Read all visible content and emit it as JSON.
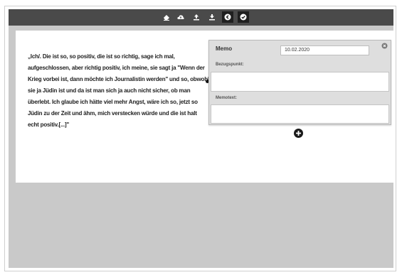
{
  "toolbar": {
    "buttons": [
      {
        "icon": "eraser-icon"
      },
      {
        "icon": "cloud-upload-icon"
      },
      {
        "icon": "upload-icon"
      },
      {
        "icon": "download-icon"
      },
      {
        "icon": "arrow-left-circle-icon"
      },
      {
        "icon": "check-circle-icon"
      }
    ]
  },
  "document": {
    "quote": "„Ich/. Die ist so, so positiv, die ist so richtig, sage ich mal, aufgeschlossen, aber richtig positiv, ich meine, sie sagt ja \"Wenn der Krieg vorbei ist, dann möchte ich Journalistin werden\" und so, obwohl sie ja Jüdin ist und da ist man sich ja auch nicht sicher, ob man überlebt. Ich glaube ich hätte viel mehr Angst, wäre ich so, jetzt so Jüdin zu der Zeit und ähm, mich verstecken würde und die ist halt echt positiv.[...]\""
  },
  "memo": {
    "title": "Memo",
    "date": "10.02.2020",
    "reference_label": "Bezugspunkt:",
    "reference_value": "",
    "text_label": "Memotext:",
    "text_value": ""
  },
  "colors": {
    "toolbar": "#4a4a4a",
    "workspace": "#c9c9c9",
    "memo_panel": "#dedede"
  }
}
